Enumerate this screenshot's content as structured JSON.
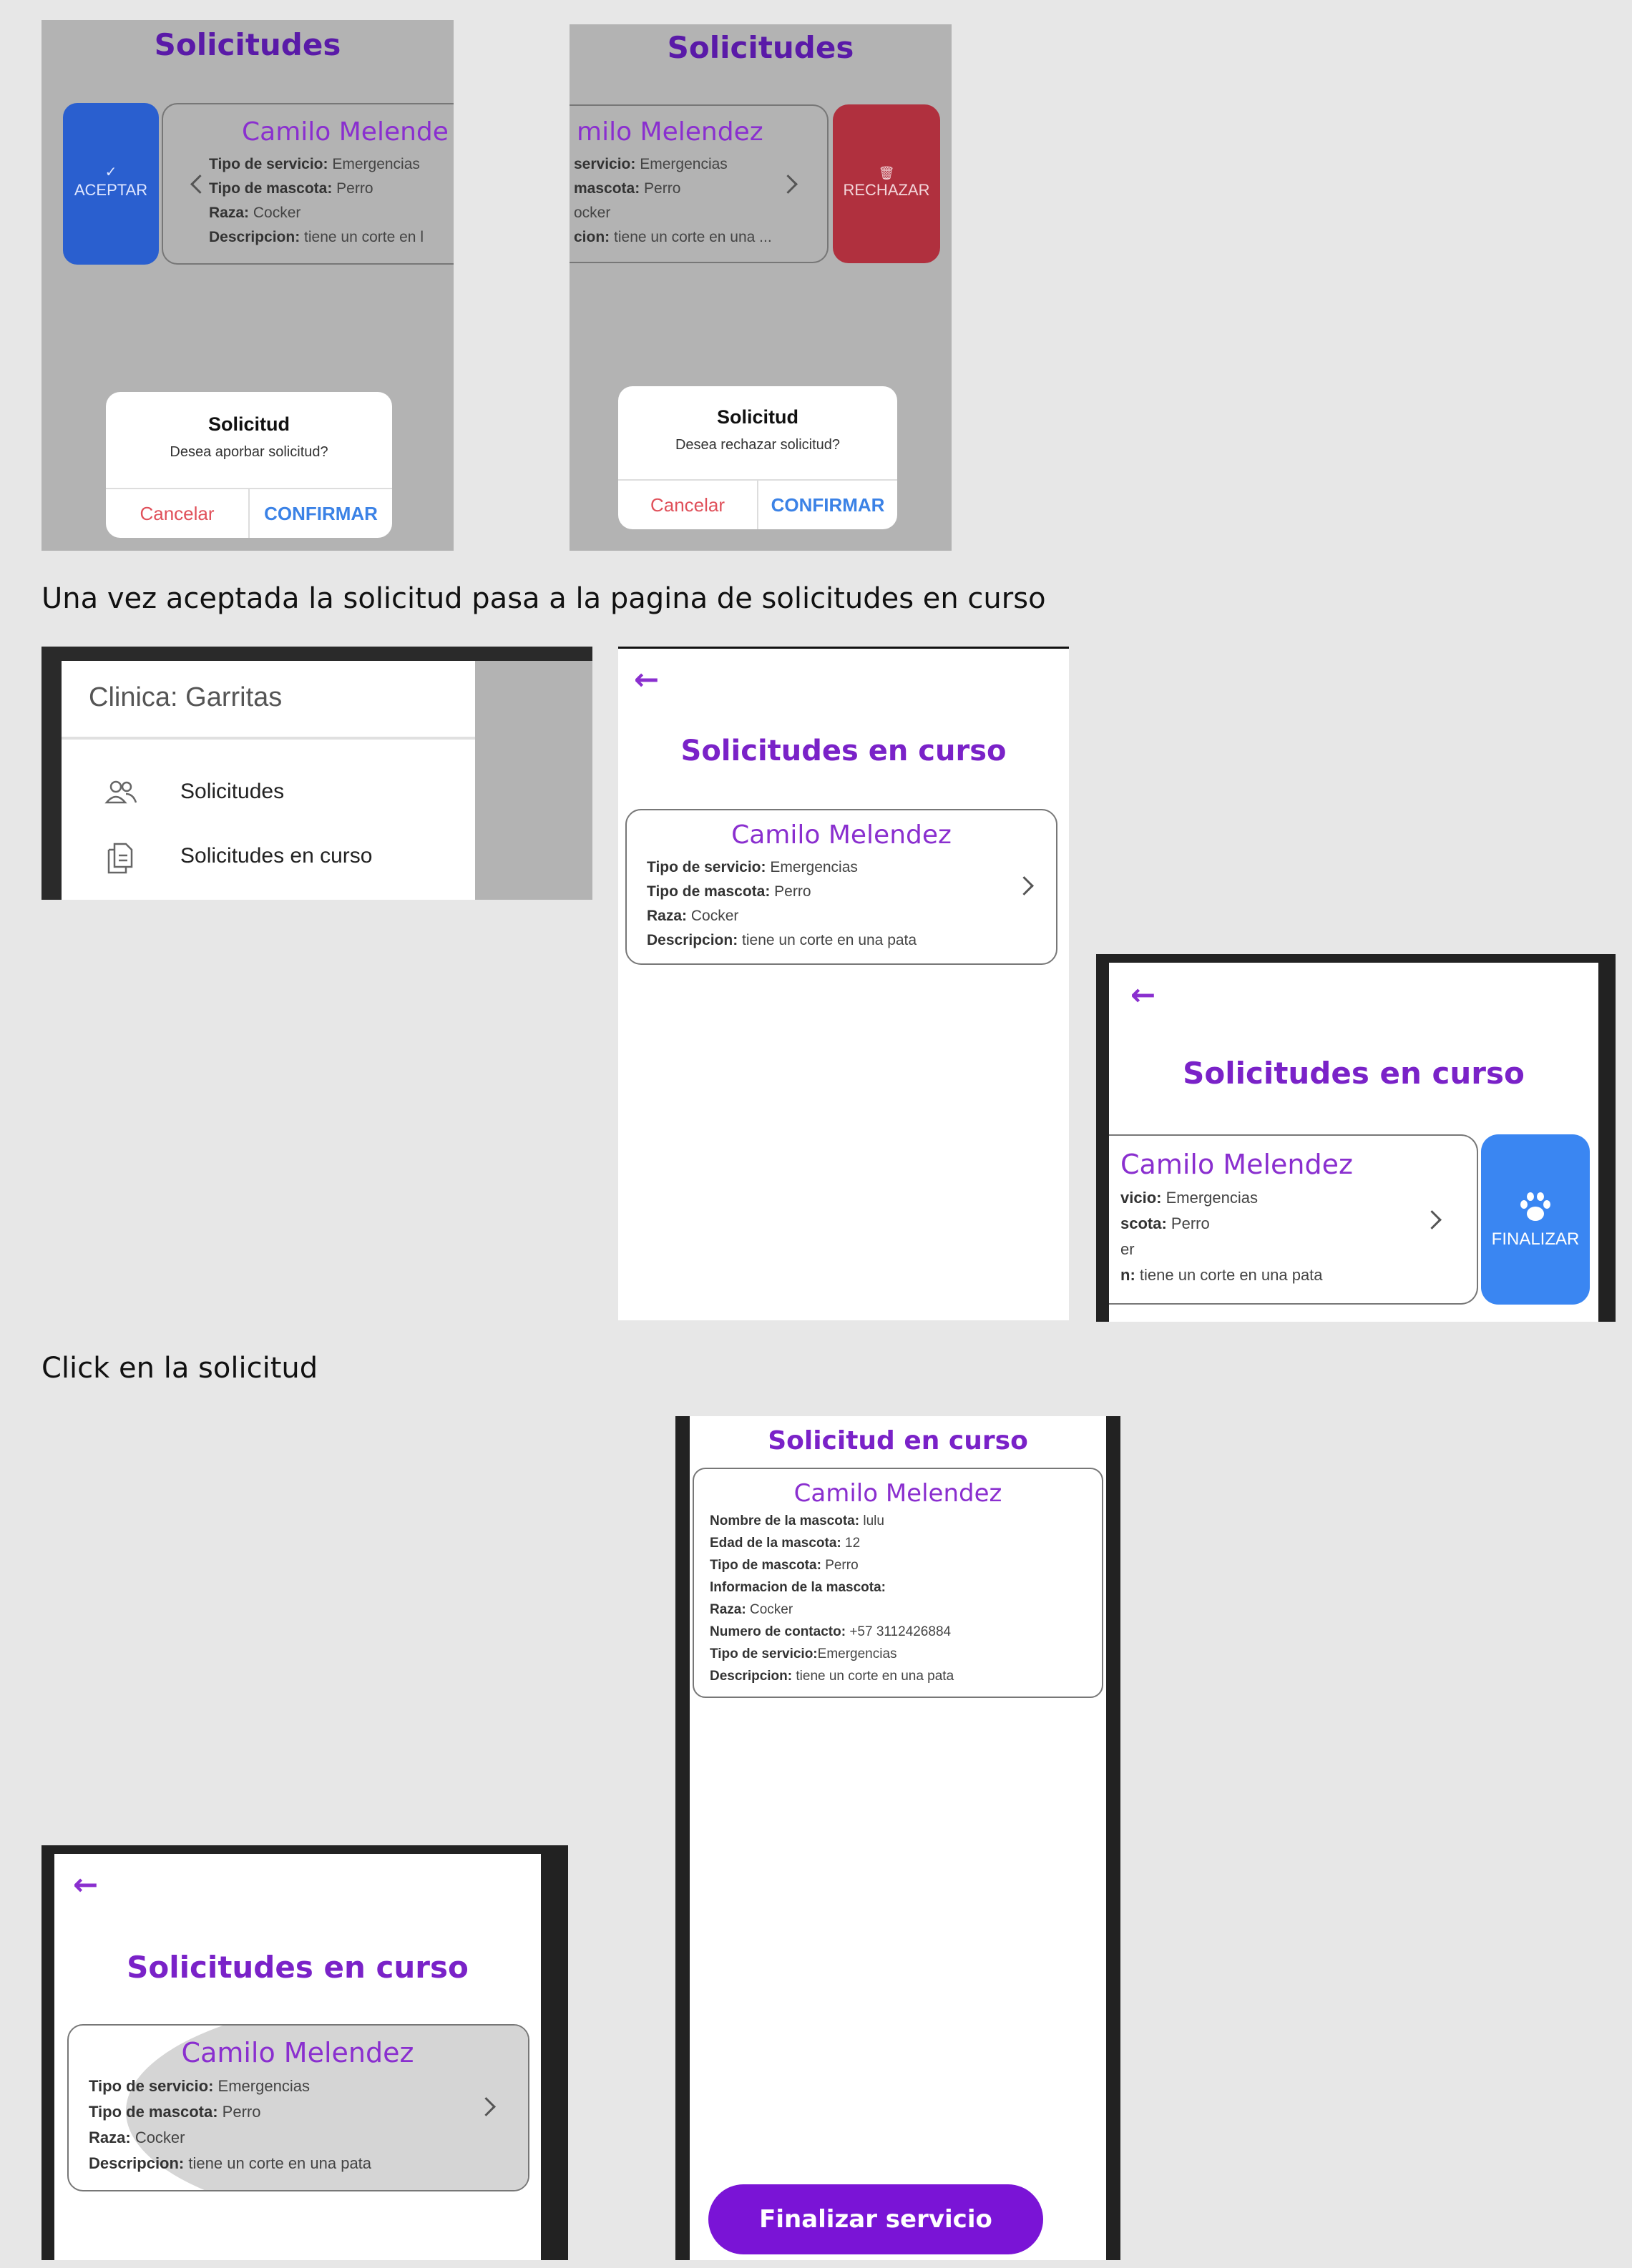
{
  "panel1": {
    "header": "Solicitudes",
    "accept_label": "ACEPTAR",
    "accept_icon": "check-icon",
    "card": {
      "name": "Camilo Melende",
      "lines": [
        {
          "label": "Tipo de servicio:",
          "value": "Emergencias"
        },
        {
          "label": "Tipo de mascota:",
          "value": "Perro"
        },
        {
          "label": "Raza:",
          "value": "Cocker"
        },
        {
          "label": "Descripcion:",
          "value": "tiene un corte en l"
        }
      ]
    },
    "dialog": {
      "title": "Solicitud",
      "message": "Desea aporbar solicitud?",
      "cancel": "Cancelar",
      "confirm": "CONFIRMAR"
    }
  },
  "panel2": {
    "header": "Solicitudes",
    "reject_label": "RECHAZAR",
    "reject_icon": "trash-icon",
    "card": {
      "name": "milo Melendez",
      "lines": [
        {
          "label": "servicio:",
          "value": "Emergencias"
        },
        {
          "label": "mascota:",
          "value": "Perro"
        },
        {
          "label": "",
          "value": "ocker"
        },
        {
          "label": "cion:",
          "value": "tiene un corte en una ..."
        }
      ]
    },
    "dialog": {
      "title": "Solicitud",
      "message": "Desea rechazar solicitud?",
      "cancel": "Cancelar",
      "confirm": "CONFIRMAR"
    }
  },
  "caption1": "Una vez aceptada la solicitud pasa a la pagina de solicitudes en curso",
  "drawer": {
    "title": "Clinica: Garritas",
    "items": [
      {
        "label": "Solicitudes",
        "icon": "users-icon"
      },
      {
        "label": "Solicitudes en curso",
        "icon": "documents-icon"
      }
    ]
  },
  "list_screen": {
    "header": "Solicitudes en curso",
    "card": {
      "name": "Camilo Melendez",
      "lines": [
        {
          "label": "Tipo de servicio:",
          "value": "Emergencias"
        },
        {
          "label": "Tipo de mascota:",
          "value": "Perro"
        },
        {
          "label": "Raza:",
          "value": "Cocker"
        },
        {
          "label": "Descripcion:",
          "value": "tiene un corte en una pata"
        }
      ]
    }
  },
  "swipe_screen": {
    "header": "Solicitudes en curso",
    "finish_label": "FINALIZAR",
    "finish_icon": "paw-icon",
    "card": {
      "name": "Camilo Melendez",
      "lines": [
        {
          "label": "vicio:",
          "value": "Emergencias"
        },
        {
          "label": "scota:",
          "value": "Perro"
        },
        {
          "label": "",
          "value": "er"
        },
        {
          "label": "n:",
          "value": "tiene un corte en una pata"
        }
      ]
    }
  },
  "caption2": "Click en la solicitud",
  "pressed_screen": {
    "header": "Solicitudes en curso",
    "card": {
      "name": "Camilo Melendez",
      "lines": [
        {
          "label": "Tipo de servicio:",
          "value": "Emergencias"
        },
        {
          "label": "Tipo de mascota:",
          "value": "Perro"
        },
        {
          "label": "Raza:",
          "value": "Cocker"
        },
        {
          "label": "Descripcion:",
          "value": "tiene un corte en una pata"
        }
      ]
    }
  },
  "detail_screen": {
    "header": "Solicitud en curso",
    "card": {
      "name": "Camilo Melendez",
      "lines": [
        {
          "label": "Nombre de la mascota:",
          "value": "lulu"
        },
        {
          "label": "Edad de la mascota:",
          "value": "12"
        },
        {
          "label": "Tipo de mascota:",
          "value": "Perro"
        },
        {
          "label": "Informacion de la mascota:",
          "value": ""
        },
        {
          "label": "Raza:",
          "value": "Cocker"
        },
        {
          "label": "Numero de contacto:",
          "value": "+57 3112426884"
        },
        {
          "label": "Tipo de servicio:",
          "value": "Emergencias"
        },
        {
          "label": "Descripcion:",
          "value": "tiene un corte en una pata"
        }
      ]
    },
    "finish_button": "Finalizar servicio"
  },
  "colors": {
    "purple": "#8a2fcf",
    "accept_blue": "#2a5fcf",
    "reject_red": "#b0303e",
    "finish_blue": "#3a86f2",
    "button_purple": "#7a14d6"
  }
}
